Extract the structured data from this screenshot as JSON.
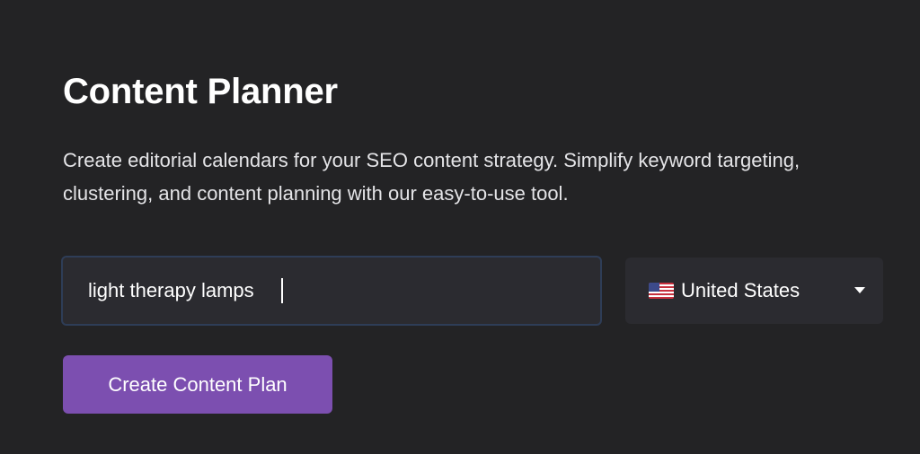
{
  "page": {
    "title": "Content Planner",
    "description": "Create editorial calendars for your SEO content strategy. Simplify keyword targeting, clustering, and content planning with our easy-to-use tool."
  },
  "keyword_input": {
    "value": "light therapy lamps"
  },
  "country_select": {
    "selected": "United States",
    "flag_icon": "us-flag-icon",
    "dropdown_icon": "chevron-down-icon"
  },
  "actions": {
    "create_label": "Create Content Plan"
  },
  "colors": {
    "background": "#232325",
    "input_background": "#2b2b30",
    "input_border": "#2e3d57",
    "accent": "#7c4fb0"
  }
}
